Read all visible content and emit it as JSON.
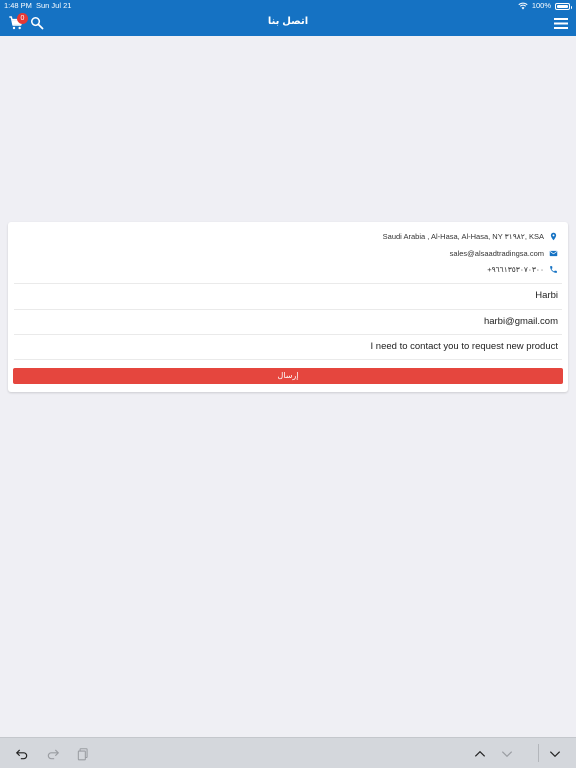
{
  "status_bar": {
    "time": "1:48 PM",
    "date": "Sun Jul 21",
    "battery": "100%"
  },
  "header": {
    "title": "اتصل بنا",
    "cart_count": "0"
  },
  "contact": {
    "address": "Saudi Arabia , Al-Hasa, Al-Hasa, NY ٣١٩٨٢, KSA",
    "email": "sales@alsaadtradingsa.com",
    "phone": "+٩٦٦١٣٥٣٠٧٠٣٠٠"
  },
  "form": {
    "name_value": "Harbi",
    "email_value": "harbi@gmail.com",
    "message_value": "I need to contact you to request new product",
    "send_label": "إرسال"
  },
  "colors": {
    "header_blue": "#1572c3",
    "send_red": "#e5463e",
    "badge_red": "#e53935",
    "background": "#efeff4"
  }
}
